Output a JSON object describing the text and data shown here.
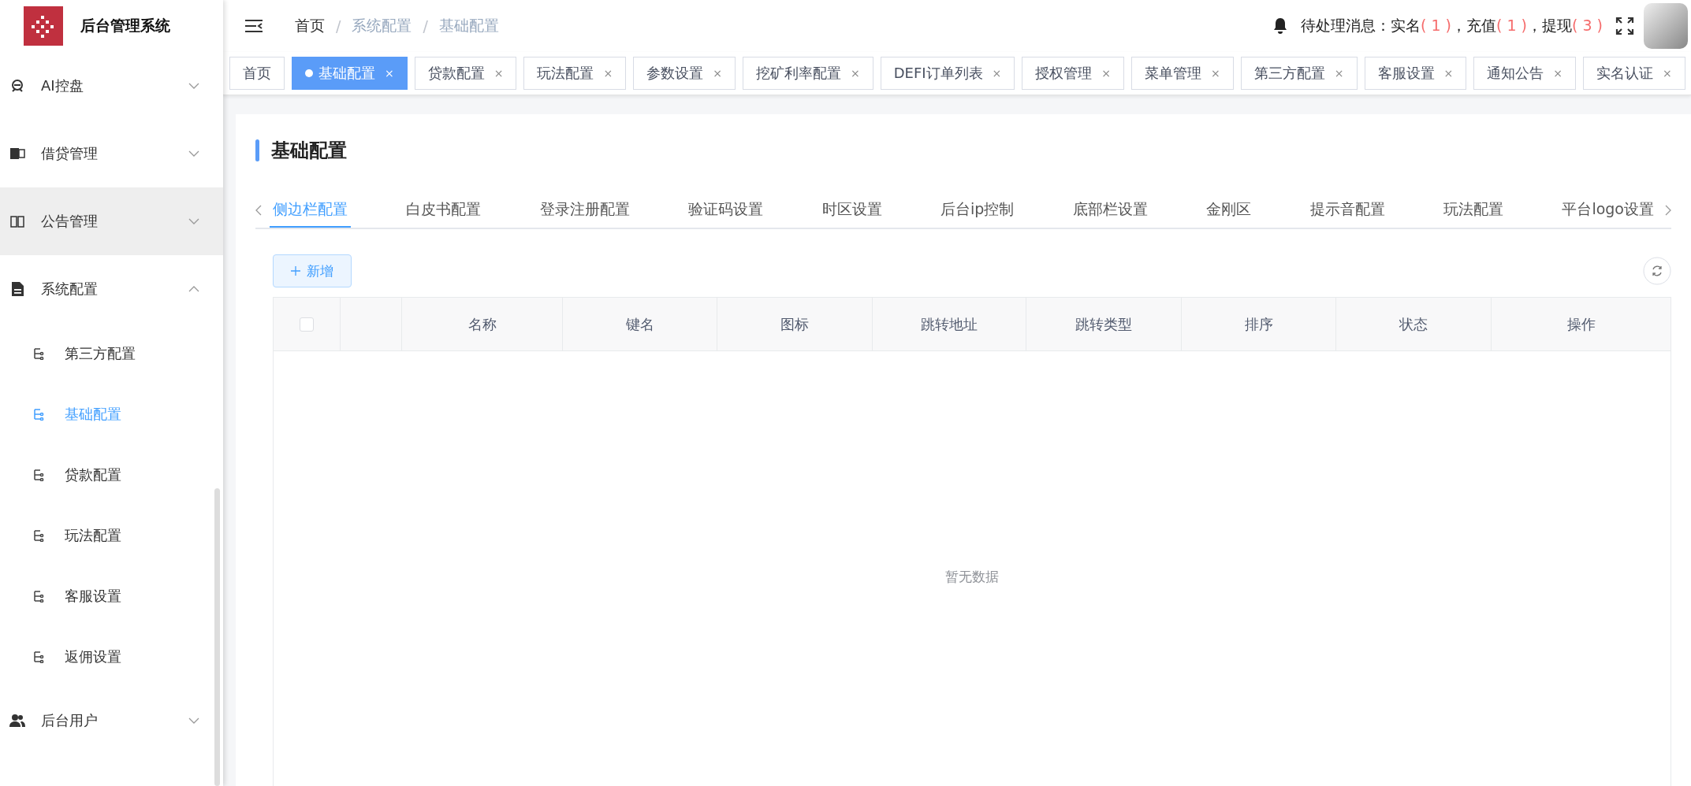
{
  "sidebar": {
    "title": "后台管理系统",
    "items": [
      {
        "label": "AI控盘",
        "expanded": false,
        "highlighted": false
      },
      {
        "label": "借贷管理",
        "expanded": false,
        "highlighted": false
      },
      {
        "label": "公告管理",
        "expanded": false,
        "highlighted": true
      },
      {
        "label": "系统配置",
        "expanded": true,
        "highlighted": false,
        "children": [
          {
            "label": "第三方配置",
            "selected": false
          },
          {
            "label": "基础配置",
            "selected": true
          },
          {
            "label": "贷款配置",
            "selected": false
          },
          {
            "label": "玩法配置",
            "selected": false
          },
          {
            "label": "客服设置",
            "selected": false
          },
          {
            "label": "返佣设置",
            "selected": false
          }
        ]
      },
      {
        "label": "后台用户",
        "expanded": false,
        "highlighted": false
      }
    ]
  },
  "breadcrumb": {
    "separator": "/",
    "items": [
      {
        "label": "首页",
        "current": false
      },
      {
        "label": "系统配置",
        "current": true
      },
      {
        "label": "基础配置",
        "current": true
      }
    ]
  },
  "tag_close": "×",
  "notice": {
    "label": "待处理消息：",
    "items": [
      {
        "name": "实名",
        "count": "( 1 )"
      },
      {
        "name": "，充值",
        "count": "( 1 )"
      },
      {
        "name": "，提现",
        "count": "( 3 )"
      }
    ]
  },
  "tags": [
    {
      "label": "首页",
      "selected": false,
      "closable": false
    },
    {
      "label": "基础配置",
      "selected": true,
      "closable": true
    },
    {
      "label": "贷款配置",
      "selected": false,
      "closable": true
    },
    {
      "label": "玩法配置",
      "selected": false,
      "closable": true
    },
    {
      "label": "参数设置",
      "selected": false,
      "closable": true
    },
    {
      "label": "挖矿利率配置",
      "selected": false,
      "closable": true
    },
    {
      "label": "DEFI订单列表",
      "selected": false,
      "closable": true
    },
    {
      "label": "授权管理",
      "selected": false,
      "closable": true
    },
    {
      "label": "菜单管理",
      "selected": false,
      "closable": true
    },
    {
      "label": "第三方配置",
      "selected": false,
      "closable": true
    },
    {
      "label": "客服设置",
      "selected": false,
      "closable": true
    },
    {
      "label": "通知公告",
      "selected": false,
      "closable": true
    },
    {
      "label": "实名认证",
      "selected": false,
      "closable": true
    }
  ],
  "page": {
    "title": "基础配置",
    "tabs": [
      {
        "label": "侧边栏配置",
        "selected": true
      },
      {
        "label": "白皮书配置",
        "selected": false
      },
      {
        "label": "登录注册配置",
        "selected": false
      },
      {
        "label": "验证码设置",
        "selected": false
      },
      {
        "label": "时区设置",
        "selected": false
      },
      {
        "label": "后台ip控制",
        "selected": false
      },
      {
        "label": "底部栏设置",
        "selected": false
      },
      {
        "label": "金刚区",
        "selected": false
      },
      {
        "label": "提示音配置",
        "selected": false
      },
      {
        "label": "玩法配置",
        "selected": false
      },
      {
        "label": "平台logo设置",
        "selected": false
      }
    ],
    "add_button": "新增",
    "table": {
      "select_all": {
        "checked": false
      },
      "columns": [
        "名称",
        "键名",
        "图标",
        "跳转地址",
        "跳转类型",
        "排序",
        "状态",
        "操作"
      ],
      "empty_text": "暂无数据"
    }
  }
}
